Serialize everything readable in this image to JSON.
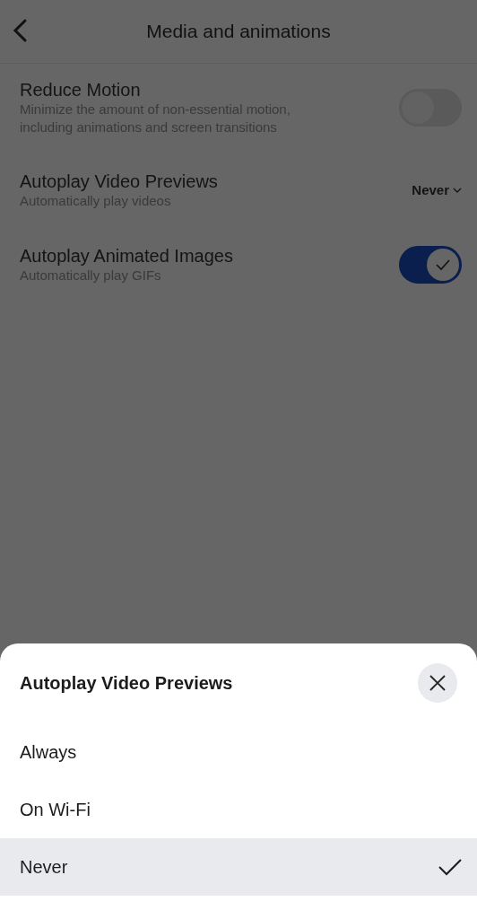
{
  "header": {
    "title": "Media and animations"
  },
  "settings": [
    {
      "kind": "toggle",
      "label": "Reduce Motion",
      "description": "Minimize the amount of non-essential motion, including animations and screen transitions",
      "on": false
    },
    {
      "kind": "select",
      "label": "Autoplay Video Previews",
      "description": "Automatically play videos",
      "value": "Never"
    },
    {
      "kind": "toggle",
      "label": "Autoplay Animated Images",
      "description": "Automatically play GIFs",
      "on": true
    }
  ],
  "sheet": {
    "title": "Autoplay Video Previews",
    "options": [
      {
        "label": "Always",
        "selected": false
      },
      {
        "label": "On Wi-Fi",
        "selected": false
      },
      {
        "label": "Never",
        "selected": true
      }
    ]
  }
}
